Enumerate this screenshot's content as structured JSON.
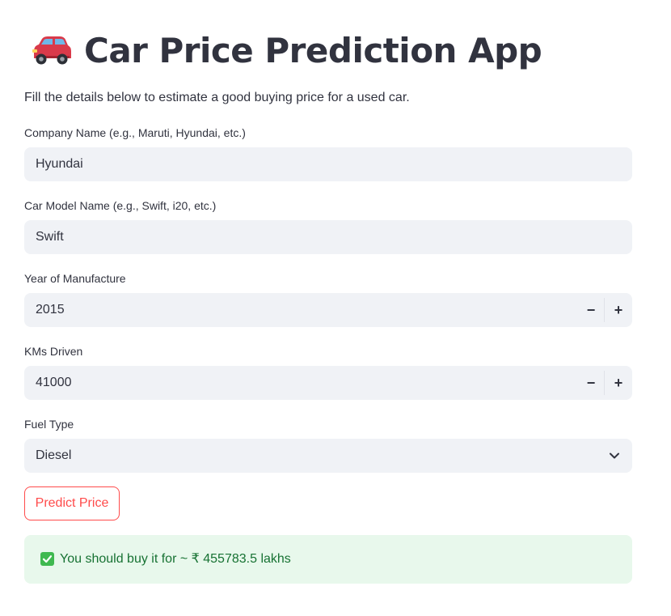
{
  "header": {
    "icon": "car-icon",
    "title": "Car Price Prediction App"
  },
  "intro": "Fill the details below to estimate a good buying price for a used car.",
  "form": {
    "company": {
      "label": "Company Name (e.g., Maruti, Hyundai, etc.)",
      "value": "Hyundai"
    },
    "model": {
      "label": "Car Model Name (e.g., Swift, i20, etc.)",
      "value": "Swift"
    },
    "year": {
      "label": "Year of Manufacture",
      "value": "2015",
      "minus": "−",
      "plus": "+"
    },
    "kms": {
      "label": "KMs Driven",
      "value": "41000",
      "minus": "−",
      "plus": "+"
    },
    "fuel": {
      "label": "Fuel Type",
      "value": "Diesel",
      "icon": "chevron-down-icon"
    }
  },
  "predict_button": "Predict Price",
  "result": {
    "icon": "check-icon",
    "text": "You should buy it for ~ ₹ 455783.5 lakhs"
  },
  "colors": {
    "accent": "#ff4b4b",
    "input_bg": "#f0f2f6",
    "success_bg": "#e8f8ec",
    "success_text": "#177233",
    "text": "#31333f"
  }
}
